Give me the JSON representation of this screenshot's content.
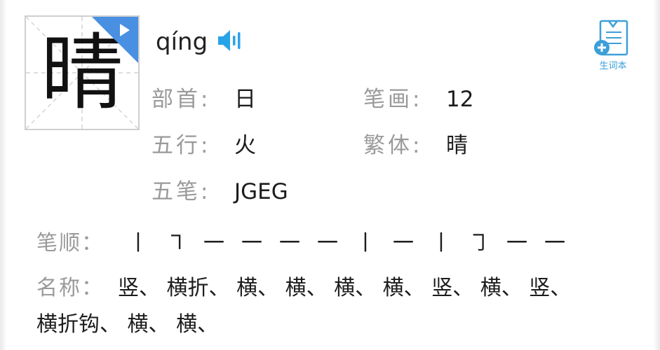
{
  "character": {
    "glyph": "晴",
    "pinyin": "qíng"
  },
  "fields": {
    "radical_label": "部首:",
    "radical_value": "日",
    "strokes_label": "笔画:",
    "strokes_value": "12",
    "wuxing_label": "五行:",
    "wuxing_value": "火",
    "traditional_label": "繁体:",
    "traditional_value": "晴",
    "wubi_label": "五笔:",
    "wubi_value": "JGEG"
  },
  "vocab_book": {
    "label": "生词本",
    "icon": "notebook-plus-icon"
  },
  "stroke_order": {
    "label": "笔顺：",
    "strokes": [
      "丨",
      "㇕",
      "一",
      "一",
      "一",
      "一",
      "丨",
      "一",
      "丨",
      "㇆",
      "一",
      "一"
    ]
  },
  "stroke_names": {
    "label": "名称：",
    "line1": "竖、 横折、 横、 横、 横、 横、 竖、 横、 竖、",
    "line2": "横折钩、 横、 横、"
  },
  "colors": {
    "accent_blue": "#3d9fd9",
    "label_gray": "#9a9a9a",
    "text_dark": "#1c1c1c"
  },
  "icons": {
    "play": "play-icon",
    "speaker": "speaker-icon"
  }
}
